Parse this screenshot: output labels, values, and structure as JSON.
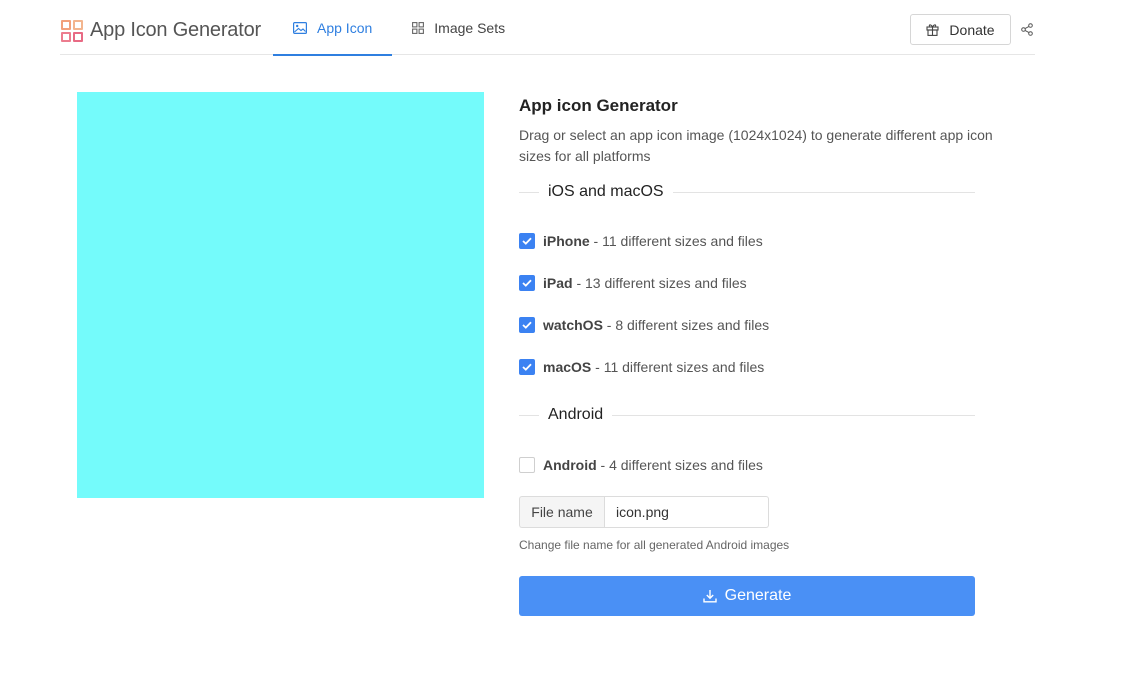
{
  "app": {
    "title": "App Icon Generator"
  },
  "nav": {
    "tabs": [
      {
        "label": "App Icon",
        "icon": "image-icon",
        "active": true
      },
      {
        "label": "Image Sets",
        "icon": "grid-icon",
        "active": false
      }
    ],
    "donate_label": "Donate"
  },
  "preview": {
    "color": "#74fbfb"
  },
  "panel": {
    "title": "App icon Generator",
    "description": "Drag or select an app icon image (1024x1024) to generate different app icon sizes for all platforms",
    "ios_section": "iOS and macOS",
    "ios_options": [
      {
        "name": "iPhone",
        "detail": " - 11 different sizes and files",
        "checked": true
      },
      {
        "name": "iPad",
        "detail": " - 13 different sizes and files",
        "checked": true
      },
      {
        "name": "watchOS",
        "detail": " - 8 different sizes and files",
        "checked": true
      },
      {
        "name": "macOS",
        "detail": " - 11 different sizes and files",
        "checked": true
      }
    ],
    "android_section": "Android",
    "android_options": [
      {
        "name": "Android",
        "detail": " - 4 different sizes and files",
        "checked": false
      }
    ],
    "file_name_label": "File name",
    "file_name_value": "icon.png",
    "file_name_help": "Change file name for all generated Android images",
    "generate_label": "Generate"
  },
  "colors": {
    "accent": "#2f7fe0",
    "button": "#4a90f5",
    "checkbox": "#3b82f2"
  }
}
